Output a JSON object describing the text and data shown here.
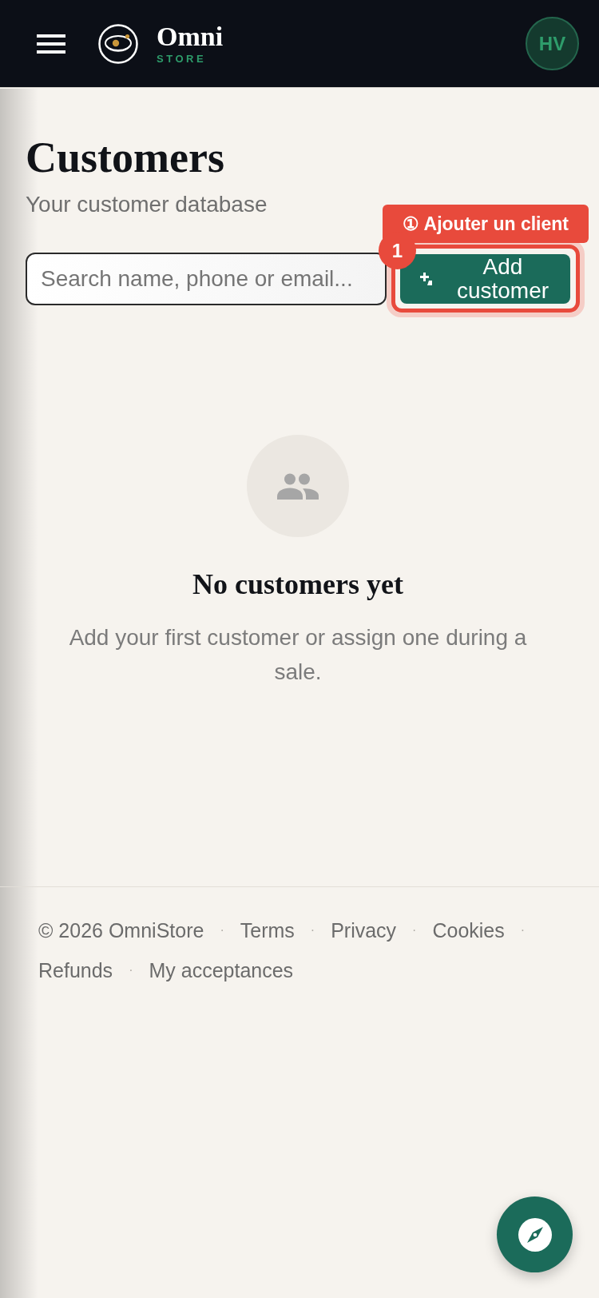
{
  "header": {
    "logo": {
      "name": "Omni",
      "tagline": "STORE"
    },
    "avatar": {
      "initials": "HV"
    }
  },
  "page": {
    "title": "Customers",
    "subtitle": "Your customer database"
  },
  "search": {
    "placeholder": "Search name, phone or email..."
  },
  "add_button": {
    "label": "Add customer"
  },
  "tour_hint": {
    "label": "① Ajouter un client",
    "step": "1"
  },
  "empty_state": {
    "title": "No customers yet",
    "message": "Add your first customer or assign one during a sale."
  },
  "footer": {
    "items": [
      {
        "kind": "text",
        "label": "© 2026 OmniStore"
      },
      {
        "kind": "separator",
        "label": "·"
      },
      {
        "kind": "link",
        "label": "Terms"
      },
      {
        "kind": "separator",
        "label": "·"
      },
      {
        "kind": "link",
        "label": "Privacy"
      },
      {
        "kind": "separator",
        "label": "·"
      },
      {
        "kind": "link",
        "label": "Cookies"
      },
      {
        "kind": "separator",
        "label": "·"
      },
      {
        "kind": "link",
        "label": "Refunds"
      },
      {
        "kind": "separator",
        "label": "·"
      },
      {
        "kind": "link",
        "label": "My acceptances"
      }
    ]
  }
}
